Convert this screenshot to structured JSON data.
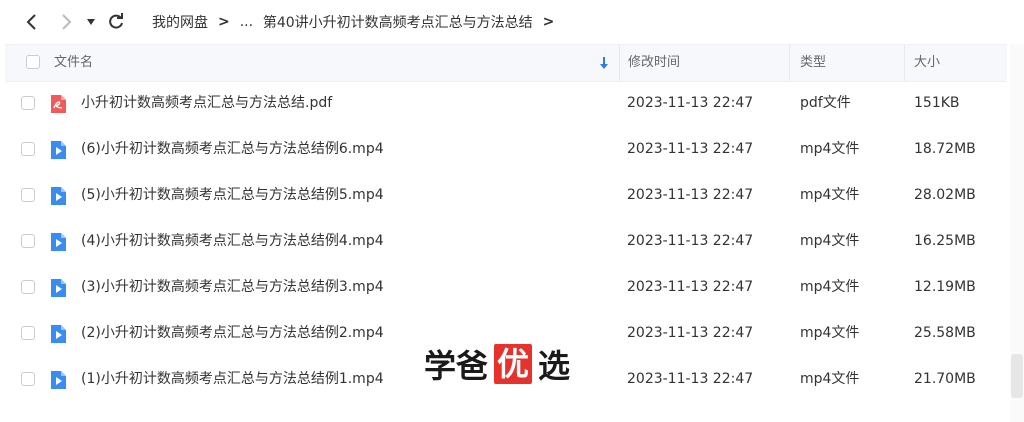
{
  "toolbar": {
    "breadcrumb": [
      {
        "label": "我的网盘"
      },
      {
        "label": "..."
      },
      {
        "label": "第40讲小升初计数高频考点汇总与方法总结"
      }
    ]
  },
  "table": {
    "headers": {
      "name": "文件名",
      "modified": "修改时间",
      "type": "类型",
      "size": "大小"
    },
    "rows": [
      {
        "name": "小升初计数高频考点汇总与方法总结.pdf",
        "modified": "2023-11-13 22:47",
        "type": "pdf文件",
        "size": "151KB",
        "icon": "pdf-icon"
      },
      {
        "name": "(6)小升初计数高频考点汇总与方法总结例6.mp4",
        "modified": "2023-11-13 22:47",
        "type": "mp4文件",
        "size": "18.72MB",
        "icon": "video-icon"
      },
      {
        "name": "(5)小升初计数高频考点汇总与方法总结例5.mp4",
        "modified": "2023-11-13 22:47",
        "type": "mp4文件",
        "size": "28.02MB",
        "icon": "video-icon"
      },
      {
        "name": "(4)小升初计数高频考点汇总与方法总结例4.mp4",
        "modified": "2023-11-13 22:47",
        "type": "mp4文件",
        "size": "16.25MB",
        "icon": "video-icon"
      },
      {
        "name": "(3)小升初计数高频考点汇总与方法总结例3.mp4",
        "modified": "2023-11-13 22:47",
        "type": "mp4文件",
        "size": "12.19MB",
        "icon": "video-icon"
      },
      {
        "name": "(2)小升初计数高频考点汇总与方法总结例2.mp4",
        "modified": "2023-11-13 22:47",
        "type": "mp4文件",
        "size": "25.58MB",
        "icon": "video-icon"
      },
      {
        "name": "(1)小升初计数高频考点汇总与方法总结例1.mp4",
        "modified": "2023-11-13 22:47",
        "type": "mp4文件",
        "size": "21.70MB",
        "icon": "video-icon"
      }
    ]
  },
  "watermark": {
    "part1": "学爸",
    "part2": "优",
    "part3": "选"
  },
  "colors": {
    "pdf": "#f05a5a",
    "video": "#3b8cf0",
    "sort_arrow": "#2f7bea"
  }
}
